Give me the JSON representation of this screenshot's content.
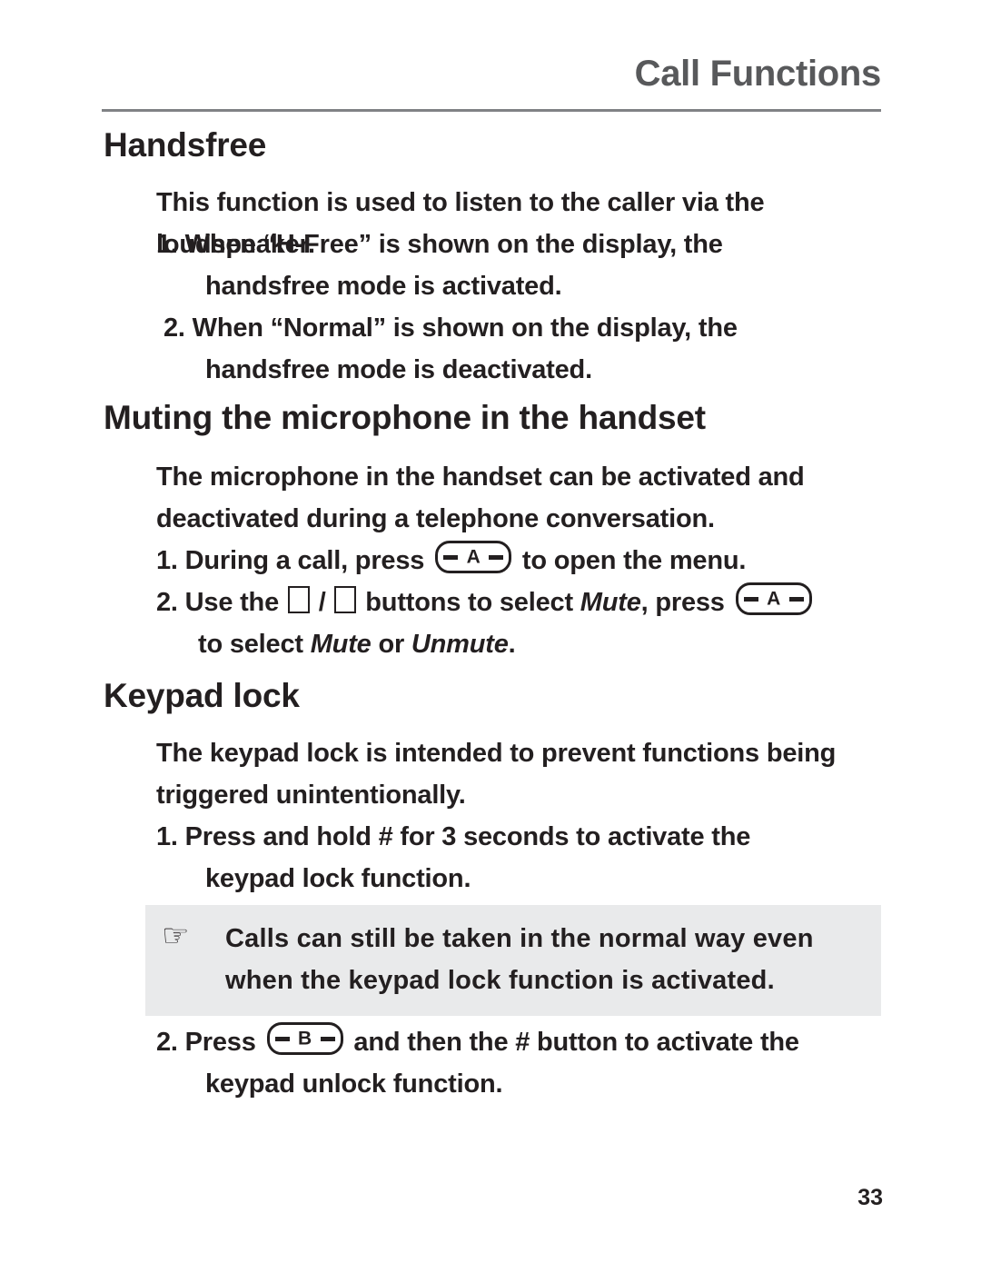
{
  "header": {
    "title": "Call Functions",
    "rule_color": "#808285",
    "title_color": "#58595b"
  },
  "sections": {
    "handsfree": {
      "heading": "Handsfree",
      "intro": "This function is used to listen to the caller via the loudspeaker.",
      "step1_a": "1. When “H-Free” is shown on the display, the",
      "step1_b": "handsfree mode is activated.",
      "step2_a": "2. When “Normal” is shown on the display, the",
      "step2_b": "handsfree mode is deactivated."
    },
    "muting": {
      "heading": "Muting the microphone in the handset",
      "intro_a": "The microphone in the handset can be activated and",
      "intro_b": "deactivated during a telephone conversation.",
      "step1_pre": "1. During a call, press",
      "step1_post": "to open the menu.",
      "step2_pre": "2. Use the",
      "step2_mid_sep": "/",
      "step2_mid": "buttons to select",
      "step2_italic1": "Mute",
      "step2_after_italic": ", press",
      "step2_line2_pre": "to select",
      "step2_italic2": "Mute",
      "step2_line2_mid": "or",
      "step2_italic3": "Unmute",
      "step2_line2_end": "."
    },
    "keypad": {
      "heading": "Keypad lock",
      "intro_a": "The keypad lock is intended to prevent functions being",
      "intro_b": "triggered unintentionally.",
      "step1_a": "1. Press and hold # for 3 seconds to activate the",
      "step1_b": "keypad lock function.",
      "step2_pre": "2. Press",
      "step2_post": "and then the # button to activate the",
      "step2_b": "keypad unlock function."
    }
  },
  "note": {
    "icon": "pointing-hand",
    "line1": "Calls can still be taken in the normal way even",
    "line2": "when the keypad lock function is activated.",
    "background": "#e9eaeb"
  },
  "keys": {
    "menu_key_label": "A",
    "back_key_label": "B"
  },
  "footer": {
    "page_number": "33"
  }
}
